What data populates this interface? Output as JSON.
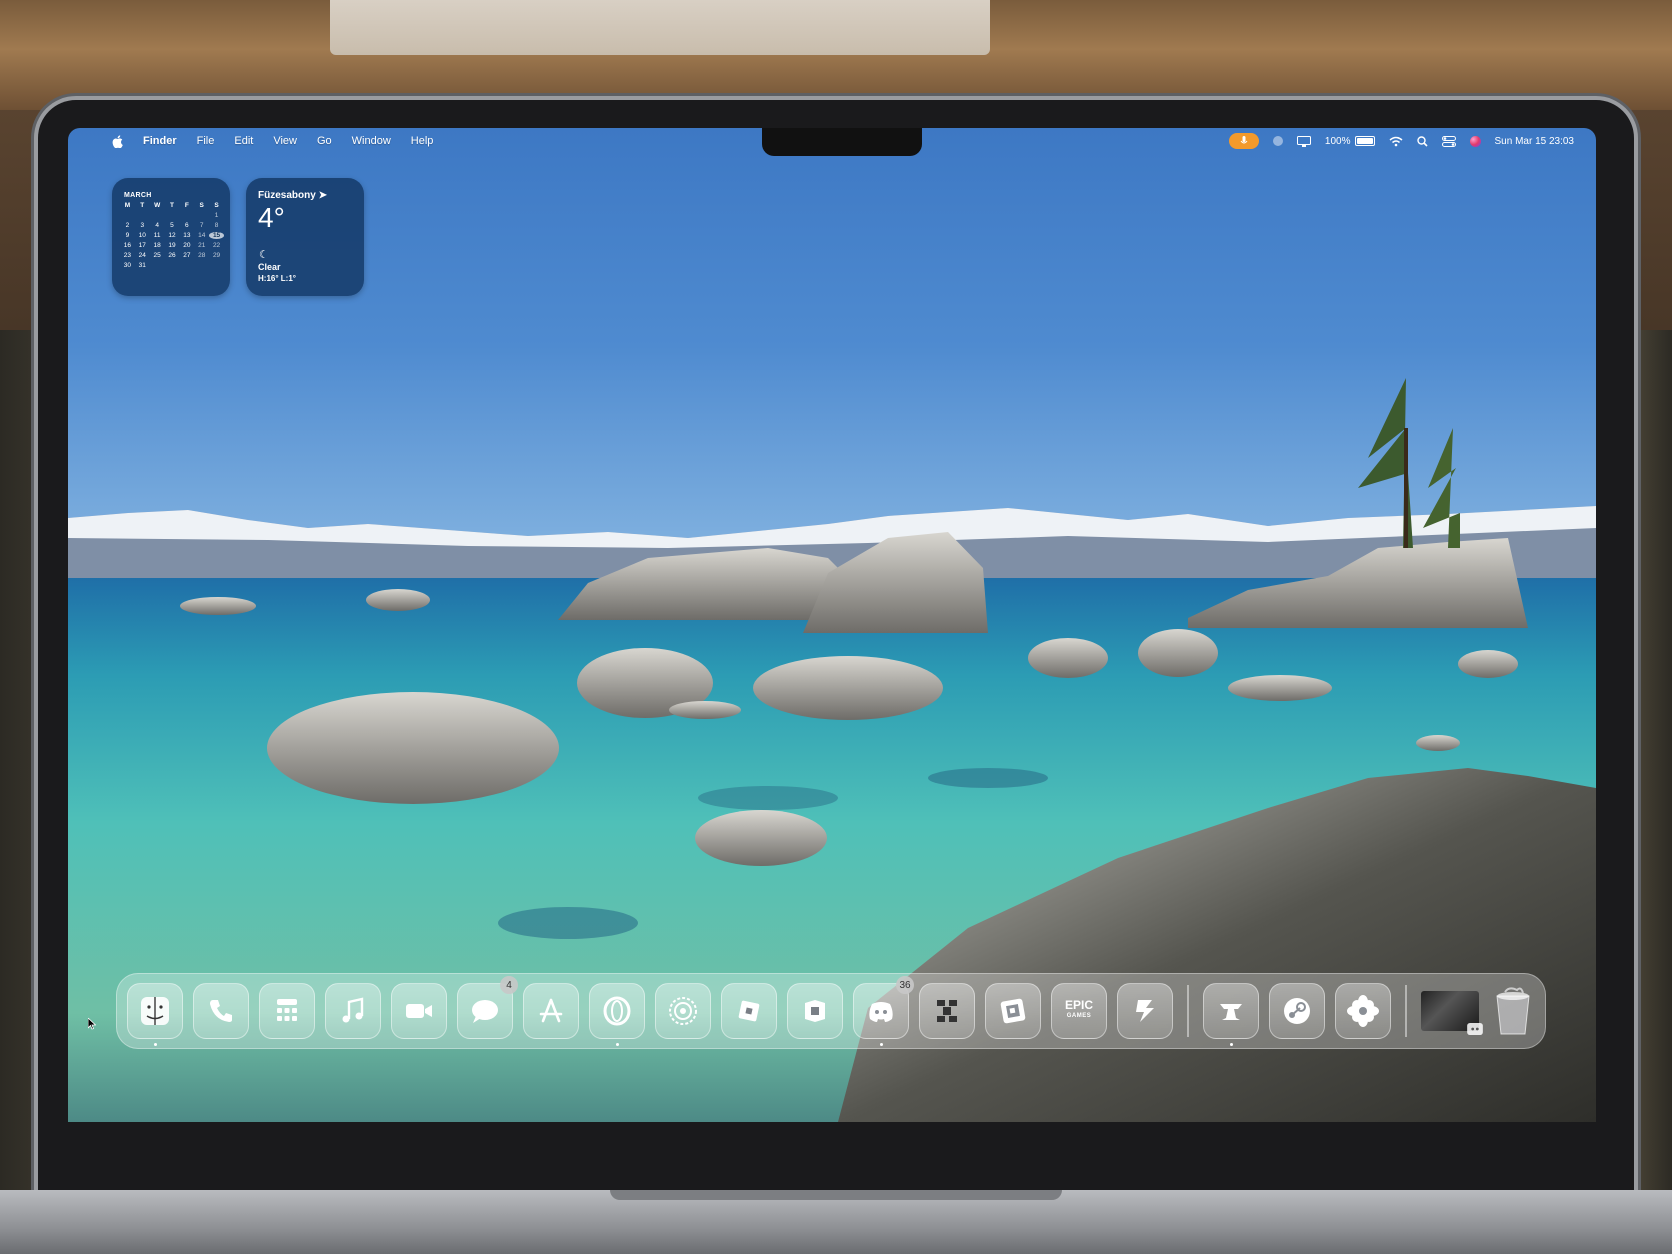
{
  "menubar": {
    "app_name": "Finder",
    "items": [
      "File",
      "Edit",
      "View",
      "Go",
      "Window",
      "Help"
    ],
    "battery": "100%",
    "datetime": "Sun Mar 15  23:03"
  },
  "calendar_widget": {
    "month": "MARCH",
    "weekdays": [
      "M",
      "T",
      "W",
      "T",
      "F",
      "S",
      "S"
    ],
    "days": [
      "",
      "",
      "",
      "",
      "",
      "",
      "1",
      "2",
      "3",
      "4",
      "5",
      "6",
      "7",
      "8",
      "9",
      "10",
      "11",
      "12",
      "13",
      "14",
      "15",
      "16",
      "17",
      "18",
      "19",
      "20",
      "21",
      "22",
      "23",
      "24",
      "25",
      "26",
      "27",
      "28",
      "29",
      "30",
      "31",
      "",
      "",
      "",
      "",
      ""
    ],
    "today": "15"
  },
  "weather_widget": {
    "city": "Füzesabony",
    "temperature": "4°",
    "condition": "Clear",
    "high_low": "H:16° L:1°"
  },
  "dock": {
    "apps": [
      {
        "name": "finder-icon",
        "running": true
      },
      {
        "name": "phone-icon"
      },
      {
        "name": "calculator-icon"
      },
      {
        "name": "music-icon"
      },
      {
        "name": "facetime-icon"
      },
      {
        "name": "messages-icon",
        "badge": "4"
      },
      {
        "name": "app-store-icon"
      },
      {
        "name": "opera-icon",
        "running": true
      },
      {
        "name": "system-settings-icon"
      },
      {
        "name": "roblox-icon"
      },
      {
        "name": "roblox-studio-icon"
      },
      {
        "name": "discord-icon",
        "badge": "36",
        "running": true
      },
      {
        "name": "crossover-icon"
      },
      {
        "name": "geometry-dash-icon"
      },
      {
        "name": "epic-games-icon",
        "label_top": "EPIC",
        "label_bottom": "GAMES"
      },
      {
        "name": "sidequest-icon"
      }
    ],
    "apps2": [
      {
        "name": "anvil-icon",
        "running": true
      },
      {
        "name": "steam-icon"
      },
      {
        "name": "flower-icon"
      }
    ]
  },
  "colors": {
    "menubar_mic": "#f39a2c",
    "badge": "#ff3b30",
    "widget_bg": "#12375f"
  }
}
